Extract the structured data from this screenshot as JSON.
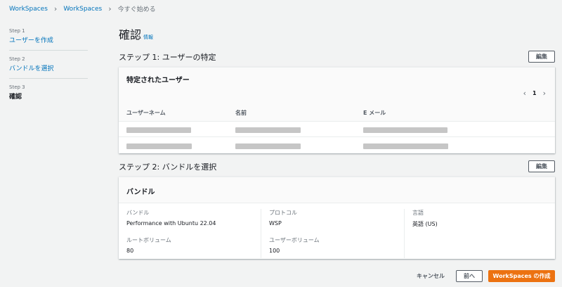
{
  "breadcrumb": {
    "items": [
      "WorkSpaces",
      "WorkSpaces"
    ],
    "current": "今すぐ始める"
  },
  "steps": [
    {
      "num": "Step 1",
      "label": "ユーザーを作成"
    },
    {
      "num": "Step 2",
      "label": "バンドルを選択"
    },
    {
      "num": "Step 3",
      "label": "確認"
    }
  ],
  "page": {
    "title": "確認",
    "info": "情報"
  },
  "section1": {
    "title": "ステップ 1: ユーザーの特定",
    "edit_label": "編集",
    "card_title": "特定されたユーザー",
    "pager_page": "1",
    "columns": [
      "ユーザーネーム",
      "名前",
      "E メール"
    ]
  },
  "section2": {
    "title": "ステップ 2: バンドルを選択",
    "edit_label": "編集",
    "card_title": "バンドル",
    "bundle_label": "バンドル",
    "bundle_value": "Performance with Ubuntu 22.04",
    "root_volume_label": "ルートボリューム",
    "root_volume_value": "80",
    "protocol_label": "プロトコル",
    "protocol_value": "WSP",
    "user_volume_label": "ユーザーボリューム",
    "user_volume_value": "100",
    "language_label": "言語",
    "language_value": "英語 (US)"
  },
  "footer": {
    "cancel_label": "キャンセル",
    "prev_label": "前へ",
    "create_label": "WorkSpaces の作成"
  }
}
